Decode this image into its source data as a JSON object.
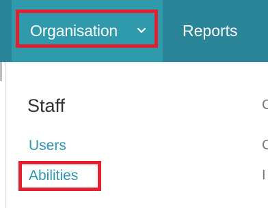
{
  "navbar": {
    "organisation_label": "Organisation",
    "reports_label": "Reports"
  },
  "dropdown": {
    "section_heading": "Staff",
    "links": [
      "Users",
      "Abilities"
    ],
    "cut_off_column": [
      "C",
      "C",
      "I"
    ]
  },
  "colors": {
    "nav_background": "#2a8598",
    "nav_active_background": "#2f9aab",
    "link_color": "#2f95b0",
    "highlight_border": "#e3202f",
    "heading_color": "#333333"
  },
  "icons": {
    "organisation_dropdown": "chevron-down-icon"
  }
}
